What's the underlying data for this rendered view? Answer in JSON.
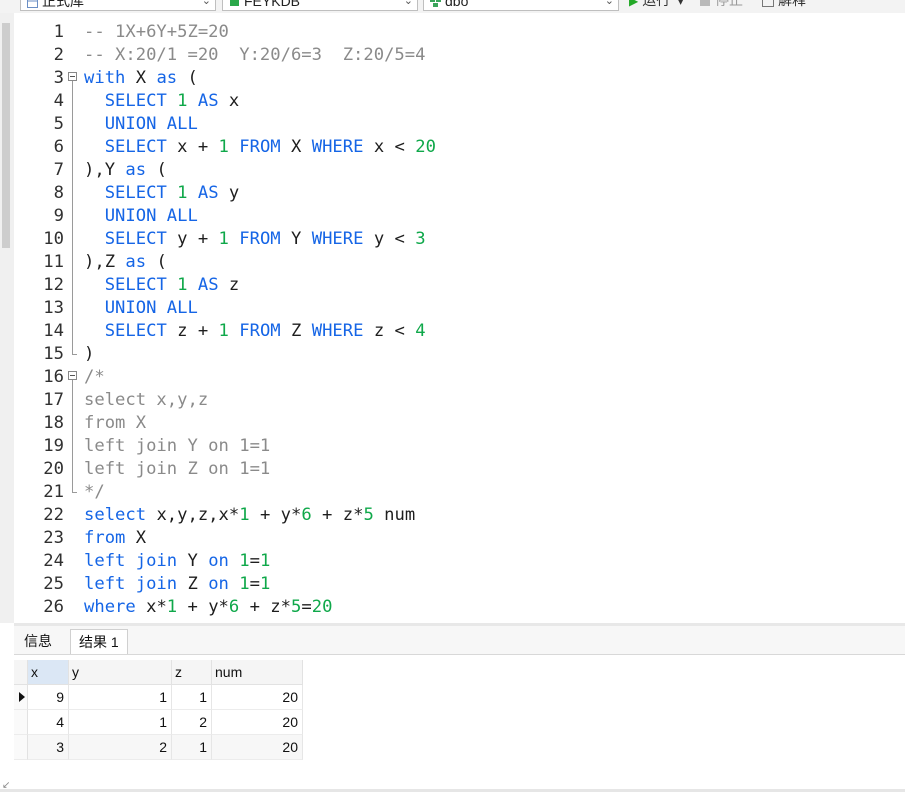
{
  "toolbar": {
    "database_combo": "正式库",
    "schema_combo": "FEYKDB",
    "owner_combo": "dbo",
    "run_label": "运行",
    "stop_label": "停止",
    "explain_label": "解释"
  },
  "editor": {
    "lines": [
      {
        "n": "1",
        "tokens": [
          [
            "cmt",
            "-- 1X+6Y+5Z=20"
          ]
        ]
      },
      {
        "n": "2",
        "tokens": [
          [
            "cmt",
            "-- X:20/1 =20  Y:20/6=3  Z:20/5=4"
          ]
        ]
      },
      {
        "n": "3",
        "tokens": [
          [
            "kw",
            "with"
          ],
          [
            "pl",
            " X "
          ],
          [
            "kw",
            "as"
          ],
          [
            "pl",
            " ("
          ]
        ]
      },
      {
        "n": "4",
        "tokens": [
          [
            "pl",
            "  "
          ],
          [
            "kw",
            "SELECT"
          ],
          [
            "pl",
            " "
          ],
          [
            "num",
            "1"
          ],
          [
            "pl",
            " "
          ],
          [
            "kw",
            "AS"
          ],
          [
            "pl",
            " x"
          ]
        ]
      },
      {
        "n": "5",
        "tokens": [
          [
            "pl",
            "  "
          ],
          [
            "kw",
            "UNION ALL"
          ]
        ]
      },
      {
        "n": "6",
        "tokens": [
          [
            "pl",
            "  "
          ],
          [
            "kw",
            "SELECT"
          ],
          [
            "pl",
            " x + "
          ],
          [
            "num",
            "1"
          ],
          [
            "pl",
            " "
          ],
          [
            "kw",
            "FROM"
          ],
          [
            "pl",
            " X "
          ],
          [
            "kw",
            "WHERE"
          ],
          [
            "pl",
            " x < "
          ],
          [
            "num",
            "20"
          ]
        ]
      },
      {
        "n": "7",
        "tokens": [
          [
            "pl",
            "),Y "
          ],
          [
            "kw",
            "as"
          ],
          [
            "pl",
            " ("
          ]
        ]
      },
      {
        "n": "8",
        "tokens": [
          [
            "pl",
            "  "
          ],
          [
            "kw",
            "SELECT"
          ],
          [
            "pl",
            " "
          ],
          [
            "num",
            "1"
          ],
          [
            "pl",
            " "
          ],
          [
            "kw",
            "AS"
          ],
          [
            "pl",
            " y"
          ]
        ]
      },
      {
        "n": "9",
        "tokens": [
          [
            "pl",
            "  "
          ],
          [
            "kw",
            "UNION ALL"
          ]
        ]
      },
      {
        "n": "10",
        "tokens": [
          [
            "pl",
            "  "
          ],
          [
            "kw",
            "SELECT"
          ],
          [
            "pl",
            " y + "
          ],
          [
            "num",
            "1"
          ],
          [
            "pl",
            " "
          ],
          [
            "kw",
            "FROM"
          ],
          [
            "pl",
            " Y "
          ],
          [
            "kw",
            "WHERE"
          ],
          [
            "pl",
            " y < "
          ],
          [
            "num",
            "3"
          ]
        ]
      },
      {
        "n": "11",
        "tokens": [
          [
            "pl",
            "),Z "
          ],
          [
            "kw",
            "as"
          ],
          [
            "pl",
            " ("
          ]
        ]
      },
      {
        "n": "12",
        "tokens": [
          [
            "pl",
            "  "
          ],
          [
            "kw",
            "SELECT"
          ],
          [
            "pl",
            " "
          ],
          [
            "num",
            "1"
          ],
          [
            "pl",
            " "
          ],
          [
            "kw",
            "AS"
          ],
          [
            "pl",
            " z"
          ]
        ]
      },
      {
        "n": "13",
        "tokens": [
          [
            "pl",
            "  "
          ],
          [
            "kw",
            "UNION ALL"
          ]
        ]
      },
      {
        "n": "14",
        "tokens": [
          [
            "pl",
            "  "
          ],
          [
            "kw",
            "SELECT"
          ],
          [
            "pl",
            " z + "
          ],
          [
            "num",
            "1"
          ],
          [
            "pl",
            " "
          ],
          [
            "kw",
            "FROM"
          ],
          [
            "pl",
            " Z "
          ],
          [
            "kw",
            "WHERE"
          ],
          [
            "pl",
            " z < "
          ],
          [
            "num",
            "4"
          ]
        ]
      },
      {
        "n": "15",
        "tokens": [
          [
            "pl",
            ")"
          ]
        ]
      },
      {
        "n": "16",
        "tokens": [
          [
            "cmt",
            "/*"
          ]
        ]
      },
      {
        "n": "17",
        "tokens": [
          [
            "cmt",
            "select x,y,z"
          ]
        ]
      },
      {
        "n": "18",
        "tokens": [
          [
            "cmt",
            "from X"
          ]
        ]
      },
      {
        "n": "19",
        "tokens": [
          [
            "cmt",
            "left join Y on 1=1"
          ]
        ]
      },
      {
        "n": "20",
        "tokens": [
          [
            "cmt",
            "left join Z on 1=1"
          ]
        ]
      },
      {
        "n": "21",
        "tokens": [
          [
            "cmt",
            "*/"
          ]
        ]
      },
      {
        "n": "22",
        "tokens": [
          [
            "kw",
            "select"
          ],
          [
            "pl",
            " x,y,z,x*"
          ],
          [
            "num",
            "1"
          ],
          [
            "pl",
            " + y*"
          ],
          [
            "num",
            "6"
          ],
          [
            "pl",
            " + z*"
          ],
          [
            "num",
            "5"
          ],
          [
            "pl",
            " num"
          ]
        ]
      },
      {
        "n": "23",
        "tokens": [
          [
            "kw",
            "from"
          ],
          [
            "pl",
            " X"
          ]
        ]
      },
      {
        "n": "24",
        "tokens": [
          [
            "kw",
            "left join"
          ],
          [
            "pl",
            " Y "
          ],
          [
            "kw",
            "on"
          ],
          [
            "pl",
            " "
          ],
          [
            "num",
            "1"
          ],
          [
            "pl",
            "="
          ],
          [
            "num",
            "1"
          ]
        ]
      },
      {
        "n": "25",
        "tokens": [
          [
            "kw",
            "left join"
          ],
          [
            "pl",
            " Z "
          ],
          [
            "kw",
            "on"
          ],
          [
            "pl",
            " "
          ],
          [
            "num",
            "1"
          ],
          [
            "pl",
            "="
          ],
          [
            "num",
            "1"
          ]
        ]
      },
      {
        "n": "26",
        "tokens": [
          [
            "kw",
            "where"
          ],
          [
            "pl",
            " x*"
          ],
          [
            "num",
            "1"
          ],
          [
            "pl",
            " + y*"
          ],
          [
            "num",
            "6"
          ],
          [
            "pl",
            " + z*"
          ],
          [
            "num",
            "5"
          ],
          [
            "pl",
            "="
          ],
          [
            "num",
            "20"
          ]
        ]
      }
    ]
  },
  "result": {
    "tabs": [
      "信息",
      "结果 1"
    ],
    "active_tab": "结果 1",
    "columns": [
      "x",
      "y",
      "z",
      "num"
    ],
    "rows": [
      [
        "9",
        "1",
        "1",
        "20"
      ],
      [
        "4",
        "1",
        "2",
        "20"
      ],
      [
        "3",
        "2",
        "1",
        "20"
      ]
    ]
  },
  "colors": {
    "keyword": "#1565e6",
    "number": "#0fa84a",
    "comment": "#8a8a8a",
    "run_icon": "#22a826"
  },
  "icons": {
    "db_combo": "database-table-icon",
    "schema_combo": "database-cylinder-icon",
    "owner_combo": "schema-icon",
    "run": "play-icon",
    "stop": "stop-icon",
    "explain": "explain-icon",
    "current_row": "row-pointer-icon"
  }
}
